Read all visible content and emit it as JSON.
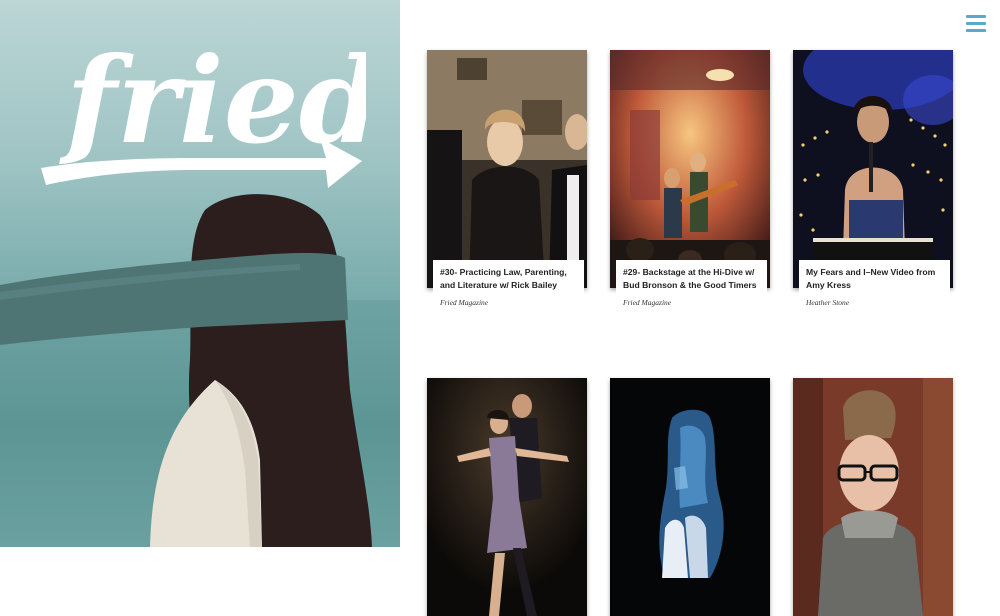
{
  "site": {
    "logo_text": "fried",
    "menu_icon": "hamburger-icon",
    "accent_color": "#5aa9c9"
  },
  "articles": [
    {
      "title": "#30- Practicing Law, Parenting, and Literature w/ Rick Bailey",
      "author": "Fried Magazine"
    },
    {
      "title": "#29- Backstage at the Hi-Dive w/ Bud Bronson & the Good Timers",
      "author": "Fried Magazine"
    },
    {
      "title": "My Fears and I–New Video from Amy Kress",
      "author": "Heather Stone"
    },
    {
      "title": "",
      "author": ""
    },
    {
      "title": "",
      "author": ""
    },
    {
      "title": "",
      "author": ""
    }
  ]
}
